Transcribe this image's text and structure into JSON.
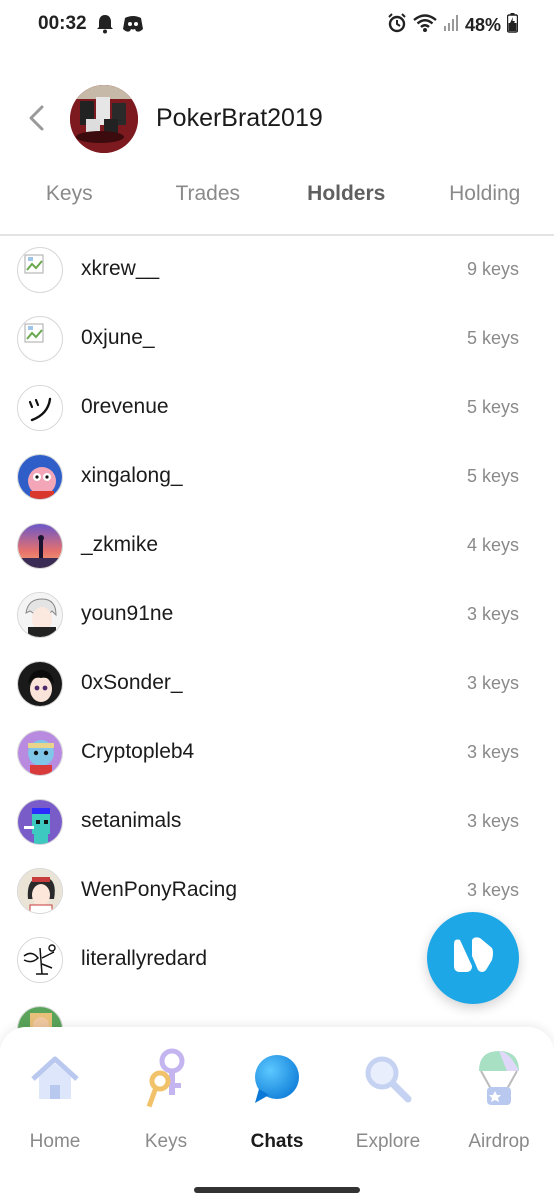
{
  "status": {
    "time": "00:32",
    "battery": "48%"
  },
  "header": {
    "title": "PokerBrat2019"
  },
  "tabs": [
    {
      "label": "Keys",
      "active": false
    },
    {
      "label": "Trades",
      "active": false
    },
    {
      "label": "Holders",
      "active": true
    },
    {
      "label": "Holding",
      "active": false
    }
  ],
  "holders": [
    {
      "name": "xkrew__",
      "keys": "9 keys"
    },
    {
      "name": "0xjune_",
      "keys": "5 keys"
    },
    {
      "name": "0revenue",
      "keys": "5 keys"
    },
    {
      "name": "xingalong_",
      "keys": "5 keys"
    },
    {
      "name": "_zkmike",
      "keys": "4 keys"
    },
    {
      "name": "youn91ne",
      "keys": "3 keys"
    },
    {
      "name": "0xSonder_",
      "keys": "3 keys"
    },
    {
      "name": "Cryptopleb4",
      "keys": "3 keys"
    },
    {
      "name": "setanimals",
      "keys": "3 keys"
    },
    {
      "name": "WenPonyRacing",
      "keys": "3 keys"
    },
    {
      "name": "literallyredard",
      "keys": ""
    }
  ],
  "nav": [
    {
      "label": "Home",
      "icon": "home-icon",
      "active": false
    },
    {
      "label": "Keys",
      "icon": "keys-icon",
      "active": false
    },
    {
      "label": "Chats",
      "icon": "chat-bubble-icon",
      "active": true
    },
    {
      "label": "Explore",
      "icon": "magnifier-icon",
      "active": false
    },
    {
      "label": "Airdrop",
      "icon": "parachute-icon",
      "active": false
    }
  ],
  "colors": {
    "accent": "#1ea7e6",
    "muted_text": "#8a8a8a"
  }
}
